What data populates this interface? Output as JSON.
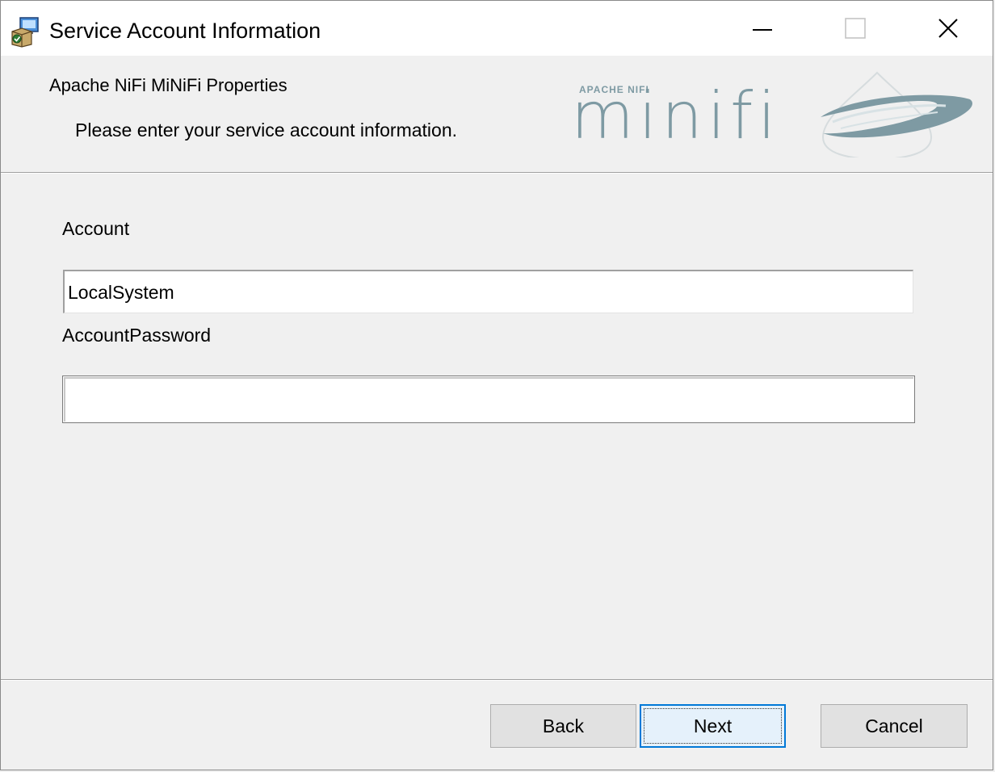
{
  "window": {
    "title": "Service Account Information",
    "controls": [
      "minimize",
      "maximize",
      "close"
    ]
  },
  "header": {
    "title": "Apache NiFi MiNiFi Properties",
    "subtitle": "Please enter your service account information.",
    "logo": {
      "small_text": "APACHE NIFI",
      "brand_text": "minifi"
    }
  },
  "form": {
    "account_label": "Account",
    "account_value": "LocalSystem",
    "password_label": "AccountPassword",
    "password_value": ""
  },
  "buttons": {
    "back": "Back",
    "next": "Next",
    "cancel": "Cancel"
  },
  "colors": {
    "accent": "#0078d7",
    "background": "#f0f0f0",
    "logo": "#7e9aa3"
  }
}
